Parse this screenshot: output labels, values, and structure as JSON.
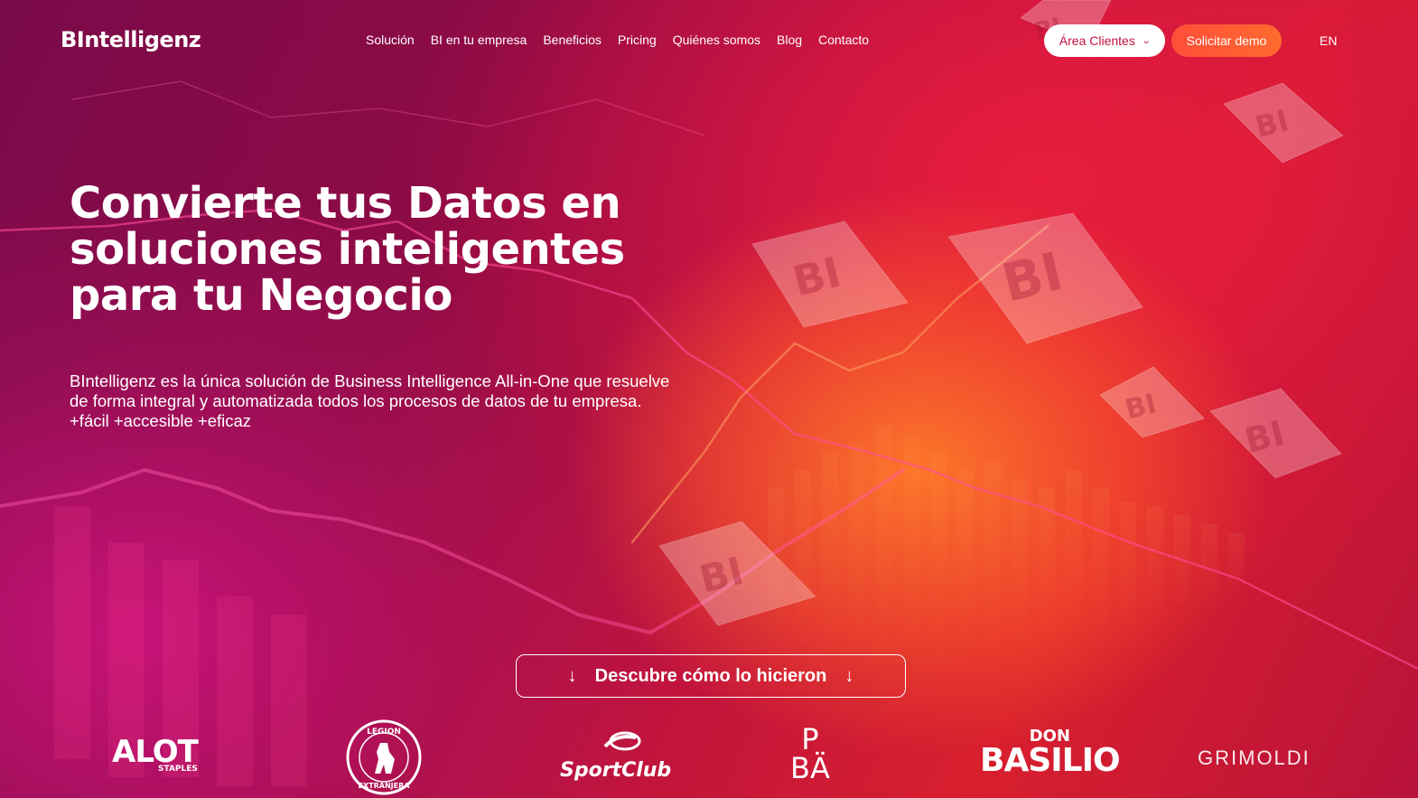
{
  "brand": {
    "logo_text": "BIntelligenz"
  },
  "nav": {
    "links": [
      "Solución",
      "BI en tu empresa",
      "Beneficios",
      "Pricing",
      "Quiénes somos",
      "Blog",
      "Contacto"
    ],
    "client_area_label": "Área Clientes",
    "demo_label": "Solicitar demo",
    "language": "EN"
  },
  "hero": {
    "headline_lines": [
      "Convierte tus Datos en",
      "soluciones inteligentes",
      "para tu Negocio"
    ],
    "subtext": "BIntelligenz es la única solución de Business Intelligence All-in-One que resuelve de forma integral y automatizada todos los procesos de datos de tu empresa. +fácil +accesible +eficaz",
    "cta_label": "Descubre cómo lo hicieron",
    "badge_text": "BI"
  },
  "clients": {
    "alot": {
      "main": "ALOT",
      "sub": "STAPLES"
    },
    "legion": {
      "top": "LEGION",
      "bottom": "EXTRANJERA"
    },
    "sportclub": "SportClub",
    "pba": {
      "line1": "P",
      "line2": "BÄ"
    },
    "basilio": {
      "top": "DON",
      "main": "BASILIO"
    },
    "grimoldi": "GRIMOLDI"
  },
  "colors": {
    "primary": "#c0143d",
    "accent_orange": "#ff5a34",
    "white": "#ffffff"
  },
  "icons": [
    "chevron-down-icon",
    "arrow-down-icon"
  ]
}
